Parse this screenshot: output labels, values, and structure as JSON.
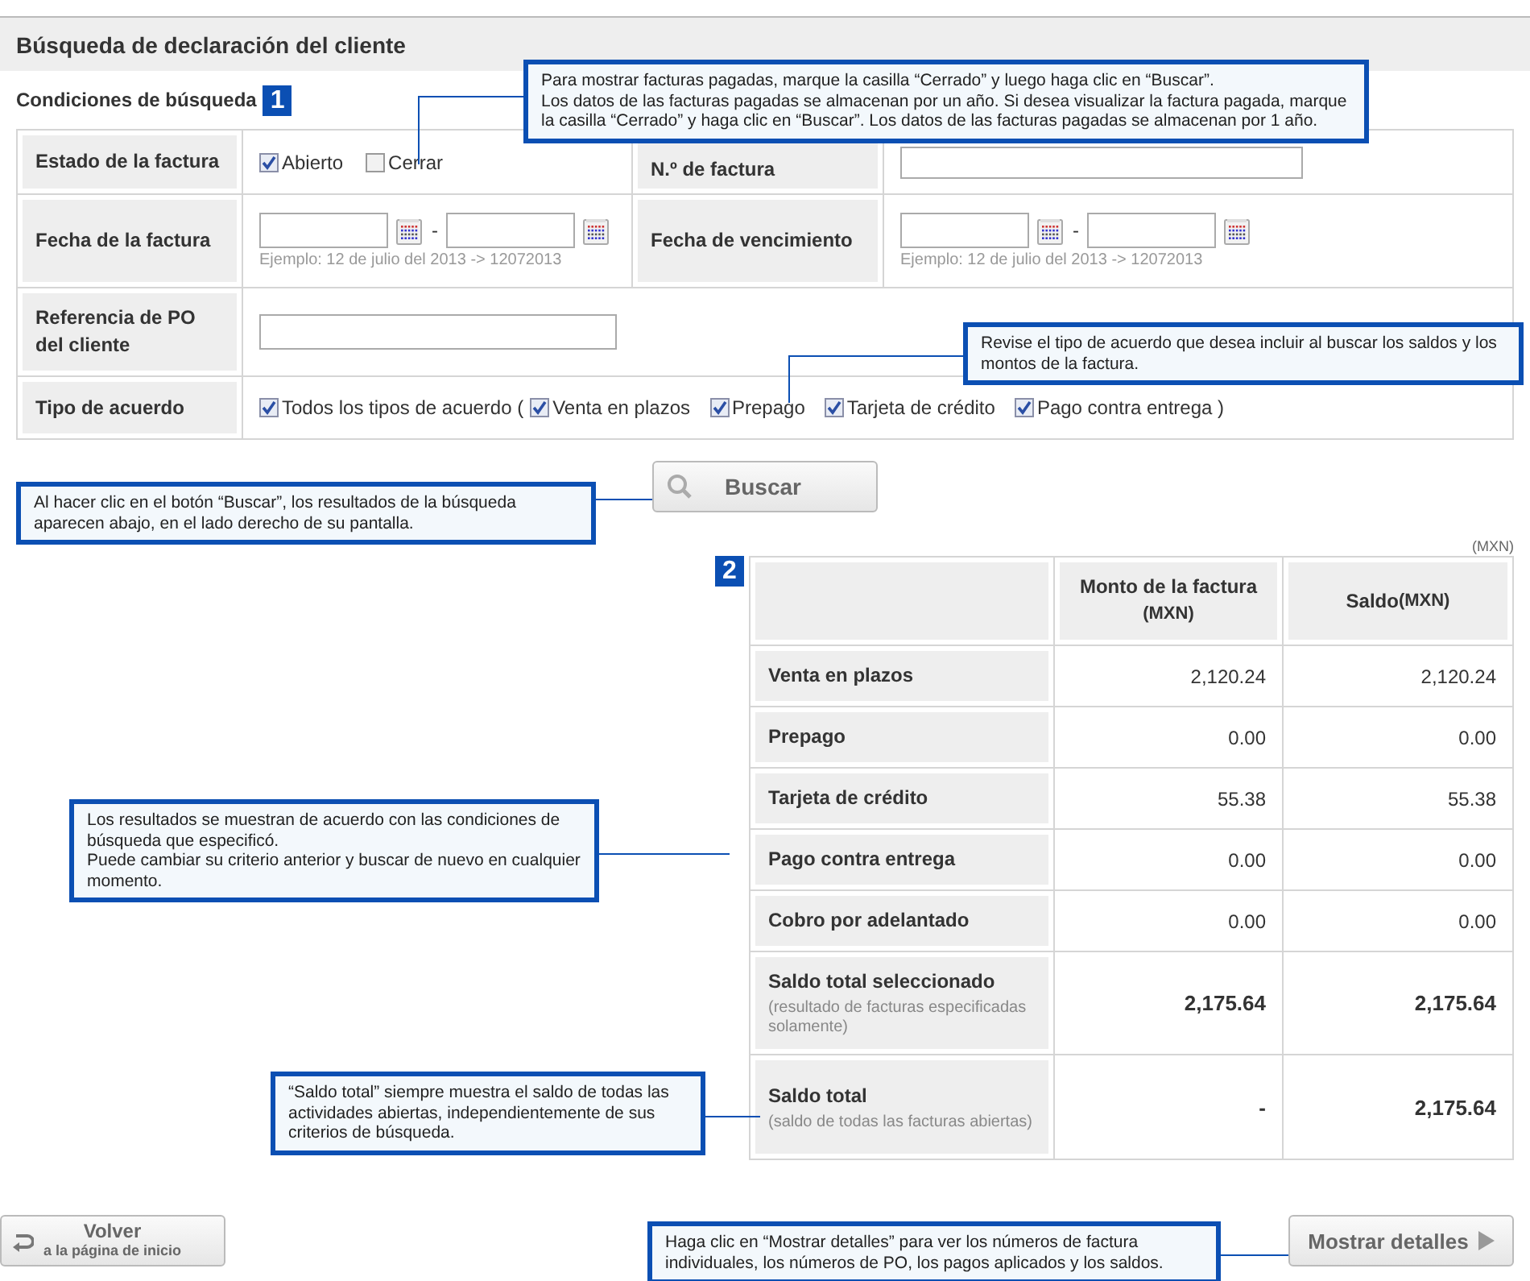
{
  "page_title": "Búsqueda de declaración del cliente",
  "search_conditions": {
    "title": "Condiciones de búsqueda",
    "step": "1",
    "invoice_status": {
      "label": "Estado de la factura",
      "options": [
        {
          "label": "Abierto",
          "checked": true
        },
        {
          "label": "Cerrar",
          "checked": false
        }
      ]
    },
    "invoice_number": {
      "label": "N.º de factura"
    },
    "invoice_date": {
      "label": "Fecha de la factura",
      "separator": "-",
      "hint": "Ejemplo: 12 de julio del 2013 -> 12072013"
    },
    "due_date": {
      "label": "Fecha de vencimiento",
      "separator": "-",
      "hint": "Ejemplo: 12 de julio del 2013 -> 12072013"
    },
    "po_reference": {
      "label": "Referencia de PO del cliente"
    },
    "agreement_type": {
      "label": "Tipo de acuerdo",
      "all": {
        "label": "Todos los tipos de acuerdo (",
        "checked": true
      },
      "options": [
        {
          "label": "Venta en plazos",
          "checked": true
        },
        {
          "label": "Prepago",
          "checked": true
        },
        {
          "label": "Tarjeta de crédito",
          "checked": true
        },
        {
          "label": "Pago contra entrega )",
          "checked": true
        }
      ]
    }
  },
  "search_button": "Buscar",
  "results": {
    "step": "2",
    "currency_note": "(MXN)",
    "columns": [
      {
        "label": "Monto de la factura",
        "unit": "(MXN)",
        "kind": "stacked"
      },
      {
        "label": "Saldo",
        "unit": "(MXN)",
        "kind": "inline"
      }
    ],
    "rows": [
      {
        "kind": "line",
        "label": "Venta en plazos",
        "values": [
          "2,120.24",
          "2,120.24"
        ]
      },
      {
        "kind": "line",
        "label": "Prepago",
        "values": [
          "0.00",
          "0.00"
        ]
      },
      {
        "kind": "line",
        "label": "Tarjeta de crédito",
        "values": [
          "55.38",
          "55.38"
        ]
      },
      {
        "kind": "line",
        "label": "Pago contra entrega",
        "values": [
          "0.00",
          "0.00"
        ]
      },
      {
        "kind": "line",
        "label": "Cobro por adelantado",
        "values": [
          "0.00",
          "0.00"
        ]
      },
      {
        "kind": "total",
        "label": "Saldo total seleccionado",
        "note": "(resultado de facturas especificadas solamente)",
        "values": [
          "2,175.64",
          "2,175.64"
        ]
      },
      {
        "kind": "total",
        "label": "Saldo total",
        "note": "(saldo de todas las facturas abiertas)",
        "values": [
          "-",
          "2,175.64"
        ]
      }
    ]
  },
  "back_button": {
    "label": "Volver",
    "sublabel": "a la página de inicio"
  },
  "details_button": {
    "label": "Mostrar detalles"
  },
  "callouts": [
    {
      "paragraphs": [
        "Para mostrar facturas pagadas, marque la casilla “Cerrado” y luego haga clic en “Buscar”.",
        "Los datos de las facturas pagadas se almacenan por un año. Si desea visualizar la factura pagada, marque la casilla “Cerrado” y haga clic en “Buscar”. Los datos de las facturas pagadas se almacenan por 1 año."
      ]
    },
    {
      "paragraphs": [
        "Revise el tipo de acuerdo que desea incluir al buscar los saldos y los montos de la factura."
      ]
    },
    {
      "paragraphs": [
        "Al hacer clic en el botón “Buscar”, los resultados de la búsqueda aparecen abajo, en el lado derecho de su pantalla."
      ]
    },
    {
      "paragraphs": [
        "Los resultados se muestran de acuerdo con las condiciones de búsqueda que especificó.",
        "Puede cambiar su criterio anterior y buscar de nuevo en cualquier momento."
      ]
    },
    {
      "paragraphs": [
        "“Saldo total” siempre muestra el saldo de todas las actividades abiertas, independientemente de sus criterios de búsqueda."
      ]
    },
    {
      "paragraphs": [
        "Haga clic en “Mostrar detalles” para ver los números de factura individuales, los números de PO, los pagos aplicados y los saldos."
      ]
    }
  ]
}
